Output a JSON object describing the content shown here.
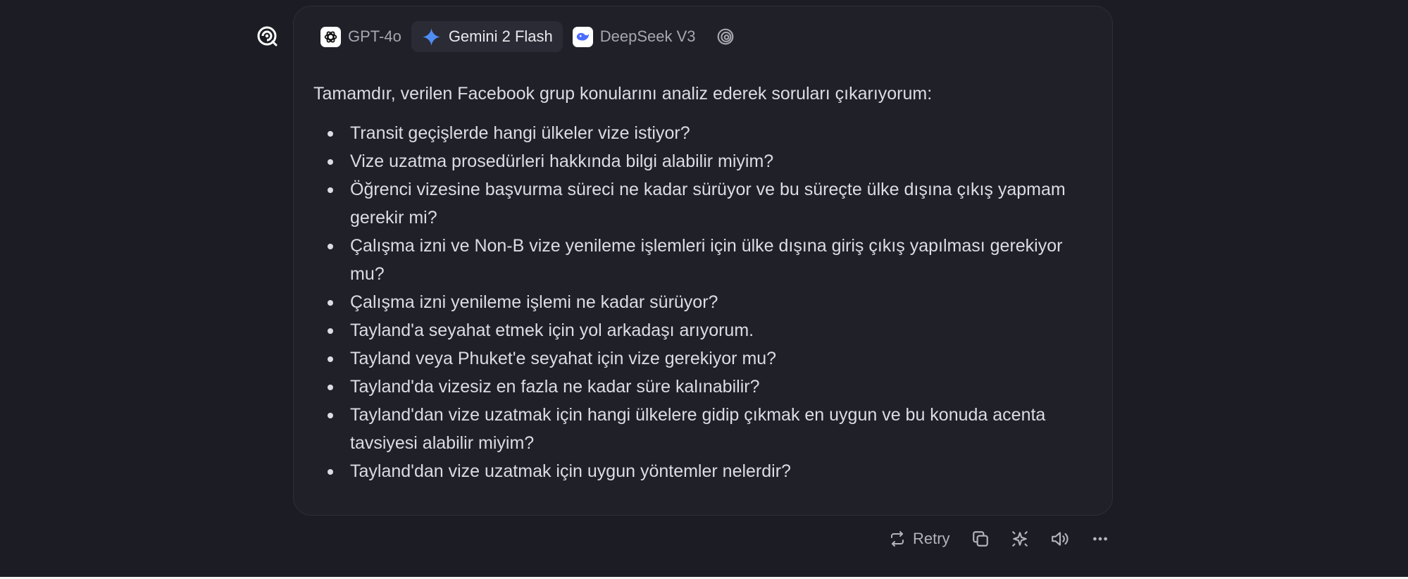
{
  "assistant": {
    "avatar_icon": "brain-spiral-icon"
  },
  "model_tabs": [
    {
      "label": "GPT-4o",
      "icon": "openai-icon",
      "active": false
    },
    {
      "label": "Gemini 2 Flash",
      "icon": "gemini-sparkle-icon",
      "active": true
    },
    {
      "label": "DeepSeek V3",
      "icon": "deepseek-whale-icon",
      "active": false
    },
    {
      "label": "",
      "icon": "spiral-model-icon",
      "active": false
    }
  ],
  "message": {
    "intro": "Tamamdır, verilen Facebook grup konularını analiz ederek soruları çıkarıyorum:",
    "bullets": [
      "Transit geçişlerde hangi ülkeler vize istiyor?",
      "Vize uzatma prosedürleri hakkında bilgi alabilir miyim?",
      "Öğrenci vizesine başvurma süreci ne kadar sürüyor ve bu süreçte ülke dışına çıkış yapmam gerekir mi?",
      "Çalışma izni ve Non-B vize yenileme işlemleri için ülke dışına giriş çıkış yapılması gerekiyor mu?",
      "Çalışma izni yenileme işlemi ne kadar sürüyor?",
      "Tayland'a seyahat etmek için yol arkadaşı arıyorum.",
      "Tayland veya Phuket'e seyahat için vize gerekiyor mu?",
      "Tayland'da vizesiz en fazla ne kadar süre kalınabilir?",
      "Tayland'dan vize uzatmak için hangi ülkelere gidip çıkmak en uygun ve bu konuda acenta tavsiyesi alabilir miyim?",
      "Tayland'dan vize uzatmak için uygun yöntemler nelerdir?"
    ]
  },
  "actions": {
    "retry_label": "Retry",
    "retry_icon": "retry-icon",
    "copy_icon": "copy-icon",
    "sparkle_icon": "sparkle-icon",
    "speaker_icon": "speaker-icon",
    "more_icon": "more-icon"
  },
  "colors": {
    "background": "#1c1c24",
    "card": "#202029",
    "text": "#dcdce2",
    "muted": "#a7a7b1",
    "gemini_blue": "#4f8df5",
    "deepseek_blue": "#4d6bfe"
  }
}
